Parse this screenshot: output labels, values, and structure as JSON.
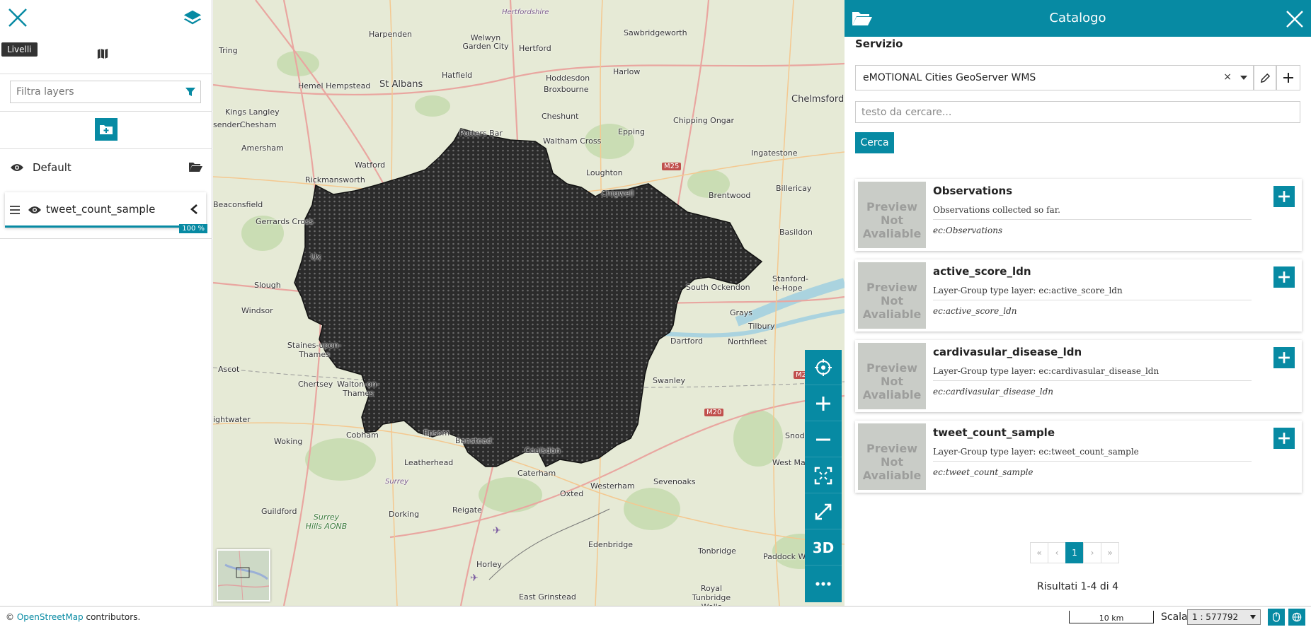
{
  "colors": {
    "accent": "#078aa3",
    "region_fill": "#2b2b2b"
  },
  "left_panel": {
    "close_icon": "close-icon",
    "layers_icon": "layers-icon",
    "tooltip": "Livelli",
    "filter_placeholder": "Filtra layers",
    "group": {
      "label": "Default"
    },
    "layer": {
      "label": "tweet_count_sample",
      "opacity": "100 %"
    }
  },
  "map": {
    "labels": [
      {
        "text": "Hertfordshire",
        "kind": "italic"
      },
      {
        "text": "Harpenden"
      },
      {
        "text": "Welwyn Garden City"
      },
      {
        "text": "Hertford"
      },
      {
        "text": "Sawbridgeworth"
      },
      {
        "text": "Tring"
      },
      {
        "text": "St Albans",
        "kind": "big"
      },
      {
        "text": "Hatfield"
      },
      {
        "text": "Hoddesdon"
      },
      {
        "text": "Harlow"
      },
      {
        "text": "Hemel Hempstead"
      },
      {
        "text": "Broxbourne"
      },
      {
        "text": "Chelmsford",
        "kind": "big"
      },
      {
        "text": "Kings Langley"
      },
      {
        "text": "Cheshunt"
      },
      {
        "text": "senden"
      },
      {
        "text": "Chesham"
      },
      {
        "text": "Potters Bar"
      },
      {
        "text": "Waltham Cross"
      },
      {
        "text": "Epping"
      },
      {
        "text": "Chipping Ongar"
      },
      {
        "text": "Amersham"
      },
      {
        "text": "Watford"
      },
      {
        "text": "Ingatestone"
      },
      {
        "text": "Rickmansworth"
      },
      {
        "text": "Loughton"
      },
      {
        "text": "Billericay"
      },
      {
        "text": "Chigwell"
      },
      {
        "text": "Brentwood"
      },
      {
        "text": "Beaconsfield"
      },
      {
        "text": "Gerrards Cross"
      },
      {
        "text": "Basildon"
      },
      {
        "text": "Ux"
      },
      {
        "text": "Stanford-le-Hope"
      },
      {
        "text": "Slough"
      },
      {
        "text": "South Ockendon"
      },
      {
        "text": "Windsor"
      },
      {
        "text": "Grays"
      },
      {
        "text": "Tilbury"
      },
      {
        "text": "Staines-upon-Thames"
      },
      {
        "text": "Dartford"
      },
      {
        "text": "Northfleet"
      },
      {
        "text": "Ascot"
      },
      {
        "text": "Chertsey"
      },
      {
        "text": "Walton-on-Thames"
      },
      {
        "text": "Swanley"
      },
      {
        "text": "ightwater"
      },
      {
        "text": "Cobham"
      },
      {
        "text": "Epsom"
      },
      {
        "text": "Banstead"
      },
      {
        "text": "Snod"
      },
      {
        "text": "Woking"
      },
      {
        "text": "Leatherhead"
      },
      {
        "text": "Coulsdon"
      },
      {
        "text": "West Malling"
      },
      {
        "text": "Surrey",
        "kind": "italic"
      },
      {
        "text": "Caterham"
      },
      {
        "text": "Westerham"
      },
      {
        "text": "Sevenoaks"
      },
      {
        "text": "Guildford"
      },
      {
        "text": "Dorking"
      },
      {
        "text": "Reigate"
      },
      {
        "text": "Oxted"
      },
      {
        "text": "Surrey Hills AONB",
        "kind": "aonb"
      },
      {
        "text": "Edenbridge"
      },
      {
        "text": "Tonbridge"
      },
      {
        "text": "Paddock Wood"
      },
      {
        "text": "Horley"
      },
      {
        "text": "Royal Tunbridge Wells"
      },
      {
        "text": "East Grinstead"
      }
    ],
    "road_badges": [
      "M25",
      "M20",
      "M2"
    ],
    "controls": [
      "locate-icon",
      "zoom-in-icon",
      "zoom-out-icon",
      "zoom-to-extent-icon",
      "fullscreen-icon",
      "3D",
      "more-icon"
    ]
  },
  "catalog": {
    "title": "Catalogo",
    "service_label": "Servizio",
    "service_value": "eMOTIONAL Cities GeoServer WMS",
    "search_placeholder": "testo da cercare...",
    "search_button": "Cerca",
    "preview_text": "Preview Not Avaliable",
    "records": [
      {
        "title": "Observations",
        "description": "Observations collected so far.",
        "name": "ec:Observations"
      },
      {
        "title": "active_score_ldn",
        "description": "Layer-Group type layer: ec:active_score_ldn",
        "name": "ec:active_score_ldn"
      },
      {
        "title": "cardivasular_disease_ldn",
        "description": "Layer-Group type layer: ec:cardivasular_disease_ldn",
        "name": "ec:cardivasular_disease_ldn"
      },
      {
        "title": "tweet_count_sample",
        "description": "Layer-Group type layer: ec:tweet_count_sample",
        "name": "ec:tweet_count_sample"
      }
    ],
    "pager": {
      "first": "«",
      "prev": "‹",
      "current": "1",
      "next": "›",
      "last": "»"
    },
    "results": "Risultati 1-4 di 4"
  },
  "footer": {
    "attribution_prefix": "© ",
    "attribution_link": "OpenStreetMap",
    "attribution_suffix": " contributors.",
    "scalebar": "10 km",
    "scale_label": "Scala:",
    "scale_value": "1 : 577792"
  }
}
